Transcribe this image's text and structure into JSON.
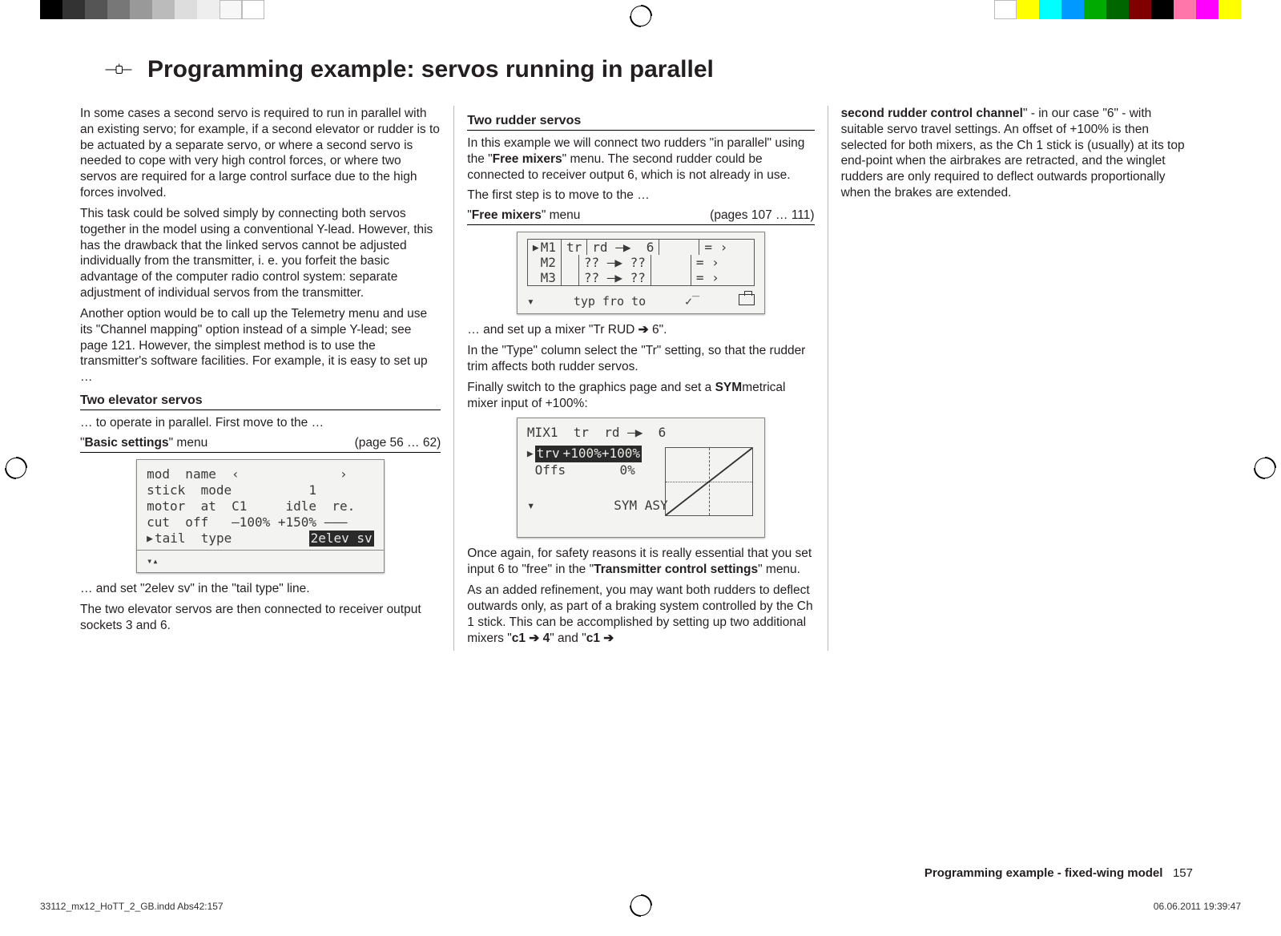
{
  "printer_bars_left": [
    "#000",
    "#333",
    "#555",
    "#777",
    "#999",
    "#bbb",
    "#ddd",
    "#eee",
    "#f7f7f7",
    "#fff"
  ],
  "printer_bars_right": [
    "#fff",
    "#ff0",
    "#0ff",
    "#09f",
    "#0a0",
    "#060",
    "#800000",
    "#000",
    "#f7a",
    "#f0f",
    "#ff0"
  ],
  "header": {
    "title": "Programming example: servos running in parallel"
  },
  "col1": {
    "p1": "In some cases a second servo is required to run in parallel with an existing servo; for example, if a second elevator or rudder is to be actuated by a separate servo, or where a second servo is needed to cope with very high control forces, or where two servos are required for a large control surface due to the high forces involved.",
    "p2": "This task could be solved simply by connecting both servos together in the model using a conventional Y-lead. However, this has the drawback that the linked servos cannot be adjusted individually from the transmitter, i. e. you forfeit the basic advantage of the computer radio control system: separate adjustment of individual servos from the transmitter.",
    "p3": "Another option would be to call up the Telemetry menu and use its \"Channel mapping\" option instead of a simple Y-lead; see page 121. However, the simplest method is to use the transmitter's software facilities. For example, it is easy to set up …",
    "sub1": "Two elevator servos",
    "p4": "… to operate in parallel. First move to the …",
    "menu_name_prefix": "\"",
    "menu_name_bold": "Basic settings",
    "menu_name_suffix": "\" menu",
    "menu_pages": "(page 56 … 62)",
    "lcd1": {
      "r1": "mod  name  ‹             ›",
      "r2": "stick  mode          1",
      "r3": "motor  at  C1     idle  re.",
      "r4": "cut  off   –100% +150% –––",
      "r5_label": "tail  type",
      "r5_value": "2elev sv"
    },
    "p5": "… and set \"2elev sv\" in the \"tail type\" line.",
    "p6": "The two elevator servos are then connected to receiver output sockets 3 and 6."
  },
  "col2": {
    "sub1": "Two rudder servos",
    "p1_a": "In this example we will connect two rudders \"in parallel\" using the \"",
    "p1_bold": "Free mixers",
    "p1_b": "\" menu. The second rudder could be connected to receiver output 6, which is not already in use.",
    "p2": "The first step is to move to the …",
    "menu_name_prefix": "\"",
    "menu_name_bold": "Free mixers",
    "menu_name_suffix": "\" menu",
    "menu_pages": "(pages 107 … 111)",
    "lcd_mix": {
      "rows": [
        {
          "id": "M1",
          "tr": "tr",
          "from": "rd",
          "arrow": "–▶",
          "to": "6",
          "eq": "= ›"
        },
        {
          "id": "M2",
          "tr": "",
          "from": "??",
          "arrow": "–▶",
          "to": "??",
          "eq": "= ›"
        },
        {
          "id": "M3",
          "tr": "",
          "from": "??",
          "arrow": "–▶",
          "to": "??",
          "eq": "= ›"
        }
      ],
      "foot_left": "▾",
      "foot_labels": "typ   fro     to"
    },
    "p3_a": "… and set up a mixer \"Tr RUD ",
    "p3_b": " 6\".",
    "p4": "In the \"Type\" column select the \"Tr\" setting, so that the rudder trim affects both rudder servos.",
    "p5_a": "Finally switch to the graphics page and set a ",
    "p5_bold": "SYM",
    "p5_b": "metrical mixer input of +100%:",
    "lcd_graph": {
      "title": "MIX1  tr  rd –▶  6",
      "trv_label": "trv",
      "trv_value": "+100%+100%",
      "offs_label": "Offs",
      "offs_value": "0%",
      "foot": "SYM ASY"
    },
    "p6_a": "Once again, for safety reasons it is really essential that you set input 6 to \"free\" in the \"",
    "p6_bold": "Transmitter control settings",
    "p6_b": "\" menu.",
    "p7_a": "As an added refinement, you may want both rudders to deflect outwards only, as part of a braking system controlled by the Ch 1 stick. This can be accomplished by setting up two additional mixers \"",
    "p7_m1a": "c1 ",
    "p7_m1b": " 4",
    "p7_mid": "\" and \"",
    "p7_m2a": "c1 ",
    "p7_m2b": ""
  },
  "col3": {
    "p1_bold": "second rudder control channel",
    "p1_rest": "\" - in our case \"6\" - with suitable servo travel settings. An offset of +100% is then selected for both mixers, as the Ch 1 stick is (usually) at its top end-point when the airbrakes are retracted, and the winglet rudders are only required to deflect outwards proportionally when the brakes are extended."
  },
  "footer": {
    "label": "Programming example - fixed-wing model",
    "page": "157"
  },
  "print_footer": {
    "left": "33112_mx12_HoTT_2_GB.indd   Abs42:157",
    "right": "06.06.2011   19:39:47"
  }
}
